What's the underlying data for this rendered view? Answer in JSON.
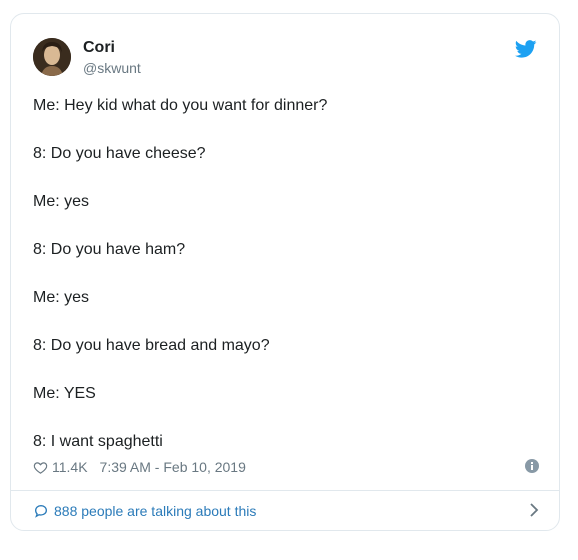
{
  "tweet": {
    "author_name": "Cori",
    "author_handle": "@skwunt",
    "lines": [
      "Me: Hey kid what do you want for dinner?",
      "",
      "8: Do you have cheese?",
      "",
      "Me: yes",
      "",
      "8: Do you have ham?",
      "",
      "Me: yes",
      "",
      "8: Do you have bread and mayo?",
      "",
      "Me: YES",
      "",
      "8: I want spaghetti"
    ],
    "likes": "11.4K",
    "timestamp": "7:39 AM - Feb 10, 2019",
    "talking_text": "888 people are talking about this"
  },
  "colors": {
    "link": "#2b7bb9",
    "muted": "#697882",
    "twitter_blue": "#1da1f2",
    "border": "#e1e8ed"
  },
  "icons": {
    "brand": "twitter-bird-icon",
    "like": "heart-icon",
    "info": "info-icon",
    "reply": "speech-bubble-icon",
    "more": "chevron-right-icon"
  }
}
